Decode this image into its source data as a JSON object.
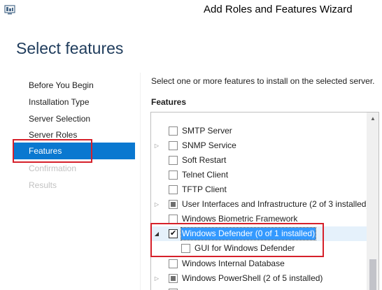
{
  "window": {
    "title": "Add Roles and Features Wizard"
  },
  "page_title": "Select features",
  "nav": {
    "items": [
      {
        "label": "Before You Begin",
        "state": "normal"
      },
      {
        "label": "Installation Type",
        "state": "normal"
      },
      {
        "label": "Server Selection",
        "state": "normal"
      },
      {
        "label": "Server Roles",
        "state": "normal"
      },
      {
        "label": "Features",
        "state": "active"
      },
      {
        "label": "Confirmation",
        "state": "disabled"
      },
      {
        "label": "Results",
        "state": "disabled"
      }
    ]
  },
  "instruction": "Select one or more features to install on the selected server.",
  "features_heading": "Features",
  "features": [
    {
      "label": "SMTP Server",
      "expander": false,
      "checkbox": "unchecked"
    },
    {
      "label": "SNMP Service",
      "expander": true,
      "checkbox": "unchecked"
    },
    {
      "label": "Soft Restart",
      "expander": false,
      "checkbox": "unchecked"
    },
    {
      "label": "Telnet Client",
      "expander": false,
      "checkbox": "unchecked"
    },
    {
      "label": "TFTP Client",
      "expander": false,
      "checkbox": "unchecked"
    },
    {
      "label": "User Interfaces and Infrastructure (2 of 3 installed)",
      "expander": true,
      "checkbox": "partial"
    },
    {
      "label": "Windows Biometric Framework",
      "expander": false,
      "checkbox": "unchecked"
    },
    {
      "label": "Windows Defender (0 of 1 installed)",
      "expander": "expanded",
      "checkbox": "checked"
    },
    {
      "label": "GUI for Windows Defender",
      "expander": false,
      "checkbox": "unchecked",
      "indent": 1
    },
    {
      "label": "Windows Internal Database",
      "expander": false,
      "checkbox": "unchecked"
    },
    {
      "label": "Windows PowerShell (2 of 5 installed)",
      "expander": true,
      "checkbox": "partial"
    }
  ],
  "colors": {
    "accent": "#0a78d0",
    "highlight": "#d6202a",
    "title": "#1f3c5c"
  }
}
